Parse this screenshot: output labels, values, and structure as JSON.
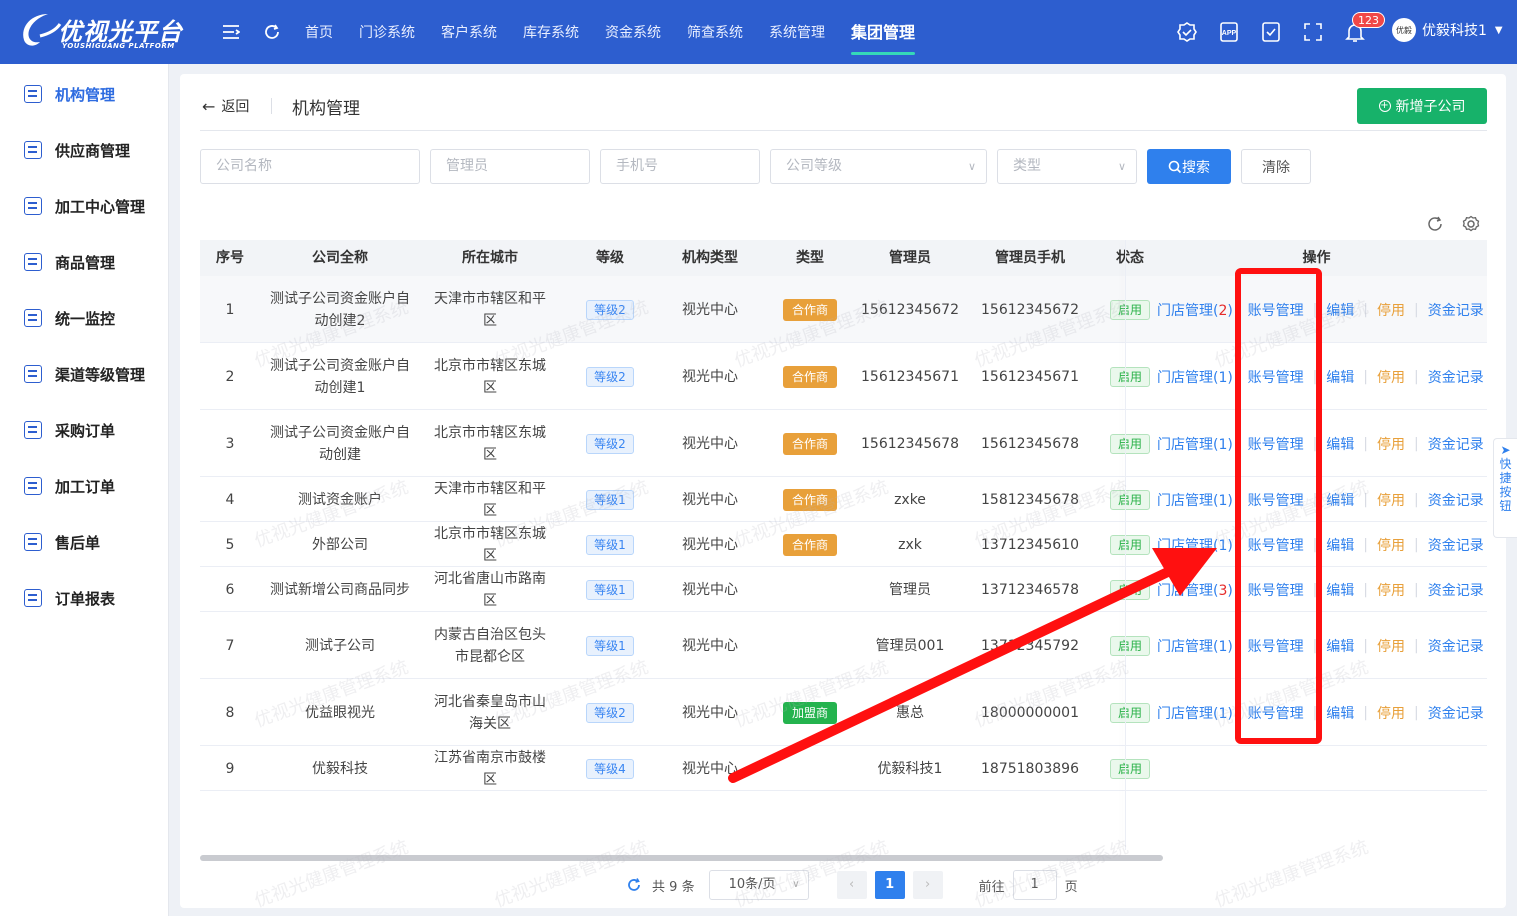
{
  "app": {
    "logo_zh": "优视光平台",
    "logo_en": "YOUSHIGUANG PLATFORM",
    "nav": [
      "首页",
      "门诊系统",
      "客户系统",
      "库存系统",
      "资金系统",
      "筛查系统",
      "系统管理",
      "集团管理"
    ],
    "active_nav": "集团管理",
    "notify_count": "123",
    "username": "优毅科技1",
    "avatar_text": "优毅"
  },
  "sidebar": {
    "items": [
      "机构管理",
      "供应商管理",
      "加工中心管理",
      "商品管理",
      "统一监控",
      "渠道等级管理",
      "采购订单",
      "加工订单",
      "售后单",
      "订单报表"
    ],
    "active": "机构管理"
  },
  "page": {
    "back_label": "返回",
    "title": "机构管理",
    "add_button": "新增子公司"
  },
  "filters": {
    "company_name": "公司名称",
    "admin": "管理员",
    "phone": "手机号",
    "level": "公司等级",
    "type": "类型",
    "search_button": "搜索",
    "clear_button": "清除"
  },
  "table": {
    "columns": [
      "序号",
      "公司全称",
      "所在城市",
      "等级",
      "机构类型",
      "类型",
      "管理员",
      "管理员手机",
      "状态",
      "操作"
    ],
    "rows": [
      {
        "no": "1",
        "name": "测试子公司资金账户自动创建2",
        "city": "天津市市辖区和平区",
        "level": "等级2",
        "org_type": "视光中心",
        "type": "合作商",
        "admin": "15612345672",
        "phone": "15612345672",
        "status": "启用",
        "store": "门店管理",
        "store_count": "2",
        "store_warn": true
      },
      {
        "no": "2",
        "name": "测试子公司资金账户自动创建1",
        "city": "北京市市辖区东城区",
        "level": "等级2",
        "org_type": "视光中心",
        "type": "合作商",
        "admin": "15612345671",
        "phone": "15612345671",
        "status": "启用",
        "store": "门店管理",
        "store_count": "1",
        "store_warn": false
      },
      {
        "no": "3",
        "name": "测试子公司资金账户自动创建",
        "city": "北京市市辖区东城区",
        "level": "等级2",
        "org_type": "视光中心",
        "type": "合作商",
        "admin": "15612345678",
        "phone": "15612345678",
        "status": "启用",
        "store": "门店管理",
        "store_count": "1",
        "store_warn": false
      },
      {
        "no": "4",
        "name": "测试资金账户",
        "city": "天津市市辖区和平区",
        "level": "等级1",
        "org_type": "视光中心",
        "type": "合作商",
        "admin": "zxke",
        "phone": "15812345678",
        "status": "启用",
        "store": "门店管理",
        "store_count": "1",
        "store_warn": false
      },
      {
        "no": "5",
        "name": "外部公司",
        "city": "北京市市辖区东城区",
        "level": "等级1",
        "org_type": "视光中心",
        "type": "合作商",
        "admin": "zxk",
        "phone": "13712345610",
        "status": "启用",
        "store": "门店管理",
        "store_count": "1",
        "store_warn": false
      },
      {
        "no": "6",
        "name": "测试新增公司商品同步",
        "city": "河北省唐山市路南区",
        "level": "等级1",
        "org_type": "视光中心",
        "type": "",
        "admin": "管理员",
        "phone": "13712346578",
        "status": "启用",
        "store": "门店管理",
        "store_count": "3",
        "store_warn": true
      },
      {
        "no": "7",
        "name": "测试子公司",
        "city": "内蒙古自治区包头市昆都仑区",
        "level": "等级1",
        "org_type": "视光中心",
        "type": "",
        "admin": "管理员001",
        "phone": "13712345792",
        "status": "启用",
        "store": "门店管理",
        "store_count": "1",
        "store_warn": false
      },
      {
        "no": "8",
        "name": "优益眼视光",
        "city": "河北省秦皇岛市山海关区",
        "level": "等级2",
        "org_type": "视光中心",
        "type": "加盟商",
        "admin": "惠总",
        "phone": "18000000001",
        "status": "启用",
        "store": "门店管理",
        "store_count": "1",
        "store_warn": false
      },
      {
        "no": "9",
        "name": "优毅科技",
        "city": "江苏省南京市鼓楼区",
        "level": "等级4",
        "org_type": "视光中心",
        "type": "",
        "admin": "优毅科技1",
        "phone": "18751803896",
        "status": "启用",
        "store": "",
        "store_count": "",
        "store_warn": false
      }
    ],
    "actions": {
      "account": "账号管理",
      "edit": "编辑",
      "disable": "停用",
      "funds": "资金记录"
    }
  },
  "pagination": {
    "total_prefix": "共",
    "total": "9",
    "total_suffix": "条",
    "page_size": "10条/页",
    "current": "1",
    "goto_prefix": "前往",
    "goto_value": "1",
    "goto_suffix": "页"
  },
  "quick_button": "快捷按钮",
  "watermark": "优视光健康管理系统",
  "colors": {
    "header": "#2d5ecf",
    "primary": "#2f80ed",
    "success": "#17b26a",
    "warning": "#e8a03a",
    "annotation": "#ff1010"
  }
}
